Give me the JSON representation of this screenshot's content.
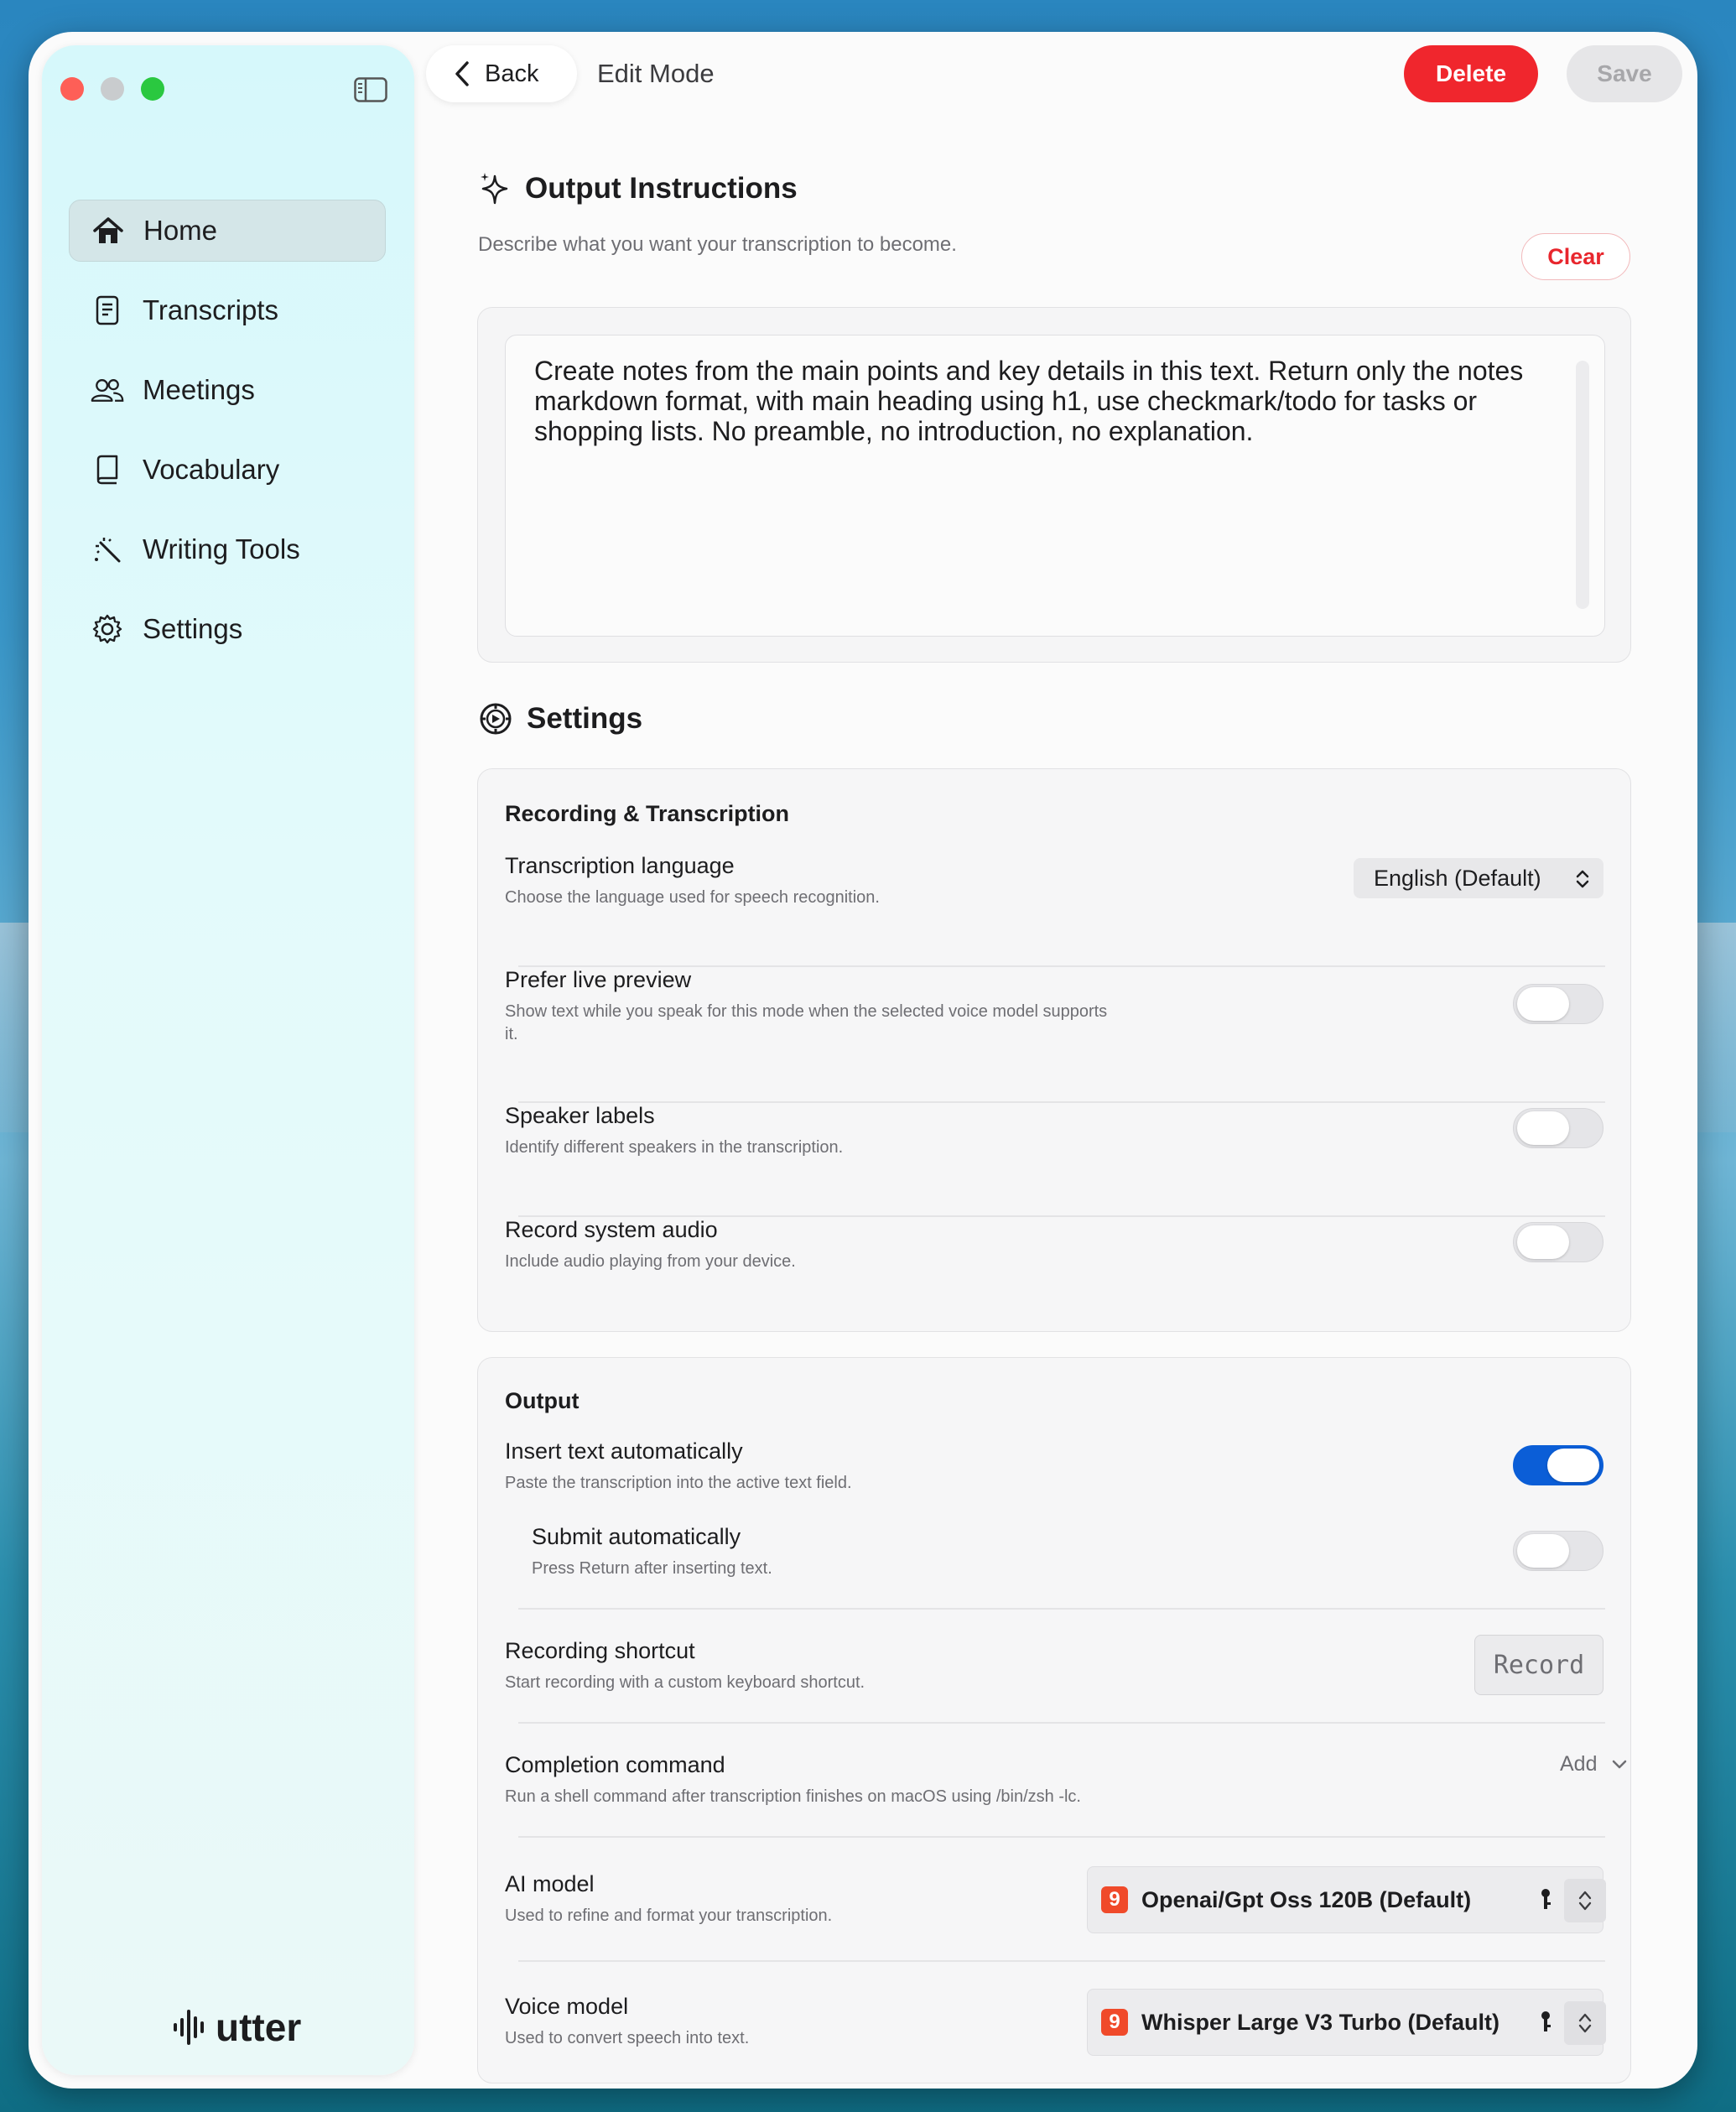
{
  "window": {
    "title": "Edit Mode"
  },
  "sidebar": {
    "items": [
      {
        "label": "Home",
        "icon": "home-icon",
        "active": true
      },
      {
        "label": "Transcripts",
        "icon": "document-icon"
      },
      {
        "label": "Meetings",
        "icon": "people-icon"
      },
      {
        "label": "Vocabulary",
        "icon": "book-icon"
      },
      {
        "label": "Writing Tools",
        "icon": "magic-wand-icon"
      },
      {
        "label": "Settings",
        "icon": "gear-icon"
      }
    ],
    "logo_text": "utter"
  },
  "toolbar": {
    "back_label": "Back",
    "title": "Edit Mode",
    "delete_label": "Delete",
    "save_label": "Save"
  },
  "output_instructions": {
    "title": "Output Instructions",
    "description": "Describe what you want your transcription to become.",
    "clear_label": "Clear",
    "text": "Create notes from the main points and key details in this text. Return only the notes markdown format, with main heading using h1, use checkmark/todo for tasks or shopping lists. No preamble, no introduction, no explanation."
  },
  "settings": {
    "title": "Settings",
    "recording": {
      "heading": "Recording & Transcription",
      "language": {
        "title": "Transcription language",
        "subtitle": "Choose the language used for speech recognition.",
        "value": "English (Default)"
      },
      "live_preview": {
        "title": "Prefer live preview",
        "subtitle": "Show text while you speak for this mode when the selected voice model supports it.",
        "on": false
      },
      "speaker_labels": {
        "title": "Speaker labels",
        "subtitle": "Identify different speakers in the transcription.",
        "on": false
      },
      "system_audio": {
        "title": "Record system audio",
        "subtitle": "Include audio playing from your device.",
        "on": false
      }
    },
    "output": {
      "heading": "Output",
      "insert_auto": {
        "title": "Insert text automatically",
        "subtitle": "Paste the transcription into the active text field.",
        "on": true
      },
      "submit_auto": {
        "title": "Submit automatically",
        "subtitle": "Press Return after inserting text.",
        "on": false
      },
      "shortcut": {
        "title": "Recording shortcut",
        "subtitle": "Start recording with a custom keyboard shortcut.",
        "button": "Record"
      },
      "completion": {
        "title": "Completion command",
        "subtitle": "Run a shell command after transcription finishes on macOS using /bin/zsh -lc.",
        "add_label": "Add"
      },
      "ai_model": {
        "title": "AI model",
        "subtitle": "Used to refine and format your transcription.",
        "value": "Openai/Gpt Oss 120B (Default)",
        "badge": "9"
      },
      "voice_model": {
        "title": "Voice model",
        "subtitle": "Used to convert speech into text.",
        "value": "Whisper Large V3 Turbo (Default)",
        "badge": "9"
      }
    }
  },
  "colors": {
    "accent": "#0b5ed7",
    "danger": "#f0262d",
    "sidebar": "#d6f8fb"
  }
}
